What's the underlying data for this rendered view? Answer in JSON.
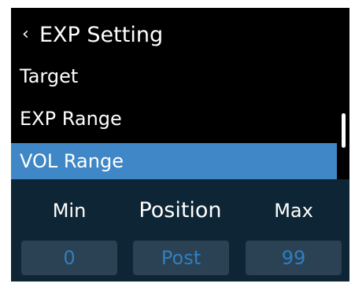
{
  "header": {
    "back_icon": "chevron-left-icon",
    "title": "EXP Setting"
  },
  "menu": {
    "items": [
      {
        "label": "Target",
        "selected": false
      },
      {
        "label": "EXP Range",
        "selected": false
      },
      {
        "label": "VOL Range",
        "selected": true
      }
    ]
  },
  "range_panel": {
    "min_label": "Min",
    "position_label": "Position",
    "max_label": "Max",
    "min_value": "0",
    "position_value": "Post",
    "max_value": "99"
  },
  "colors": {
    "background": "#000000",
    "selected": "#3f87c6",
    "panel": "#0e2535",
    "value_box": "#2a4254",
    "value_text": "#2f7fc1"
  }
}
